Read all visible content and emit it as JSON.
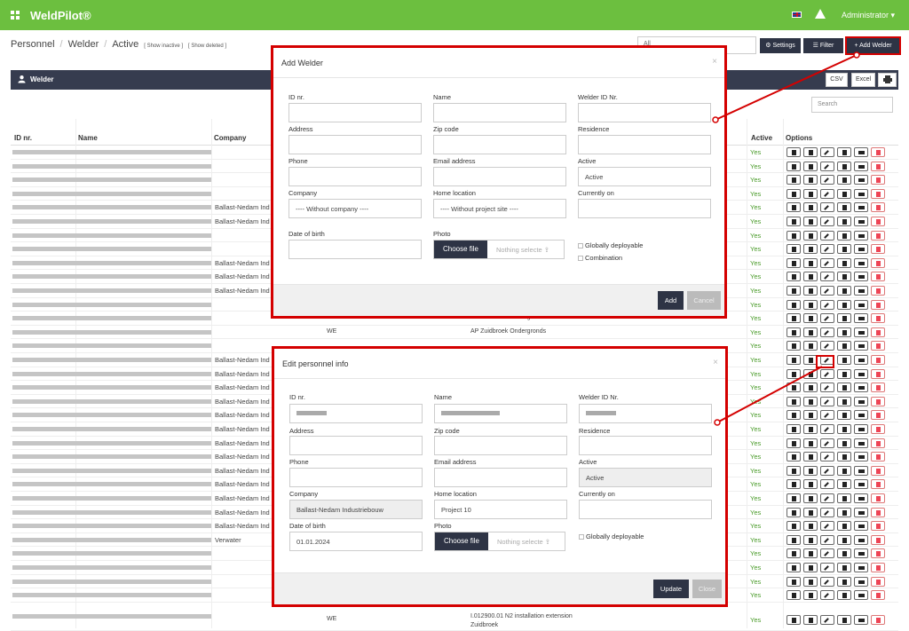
{
  "app": {
    "brand": "WeldPilot®",
    "user": "Administrator ▾"
  },
  "breadcrumb": {
    "personnel": "Personnel",
    "welder": "Welder",
    "active": "Active",
    "show_inactive": "[ Show inactive ]",
    "show_deleted": "[ Show deleted ]"
  },
  "toolbar": {
    "search_value": "All",
    "settings": "⚙ Settings",
    "filter": "☰ Filter",
    "add_welder": "+ Add Welder"
  },
  "section": {
    "title": "Welder",
    "csv": "CSV",
    "excel": "Excel"
  },
  "table": {
    "search_placeholder": "Search",
    "headers": {
      "id": "ID nr.",
      "name": "Name",
      "company": "Company",
      "active": "Active",
      "options": "Options"
    },
    "rows": [
      {
        "company": "",
        "we": "",
        "location": "",
        "active": "Yes"
      },
      {
        "company": "",
        "we": "",
        "location": "",
        "active": "Yes"
      },
      {
        "company": "",
        "we": "",
        "location": "",
        "active": "Yes"
      },
      {
        "company": "",
        "we": "",
        "location": "",
        "active": "Yes"
      },
      {
        "company": "Ballast-Nedam Ind",
        "we": "",
        "location": "",
        "active": "Yes"
      },
      {
        "company": "Ballast-Nedam Ind",
        "we": "",
        "location": "",
        "active": "Yes"
      },
      {
        "company": "",
        "we": "",
        "location": "",
        "active": "Yes"
      },
      {
        "company": "",
        "we": "",
        "location": "",
        "active": "Yes"
      },
      {
        "company": "Ballast-Nedam Ind",
        "we": "",
        "location": "",
        "active": "Yes"
      },
      {
        "company": "Ballast-Nedam Ind",
        "we": "",
        "location": "",
        "active": "Yes"
      },
      {
        "company": "Ballast-Nedam Ind",
        "we": "",
        "location": "",
        "active": "Yes"
      },
      {
        "company": "",
        "we": "",
        "location": "",
        "active": "Yes"
      },
      {
        "company": "",
        "we": "WE",
        "location": "AP Zuidbroek Ondergronds",
        "active": "Yes"
      },
      {
        "company": "",
        "we": "WE",
        "location": "AP Zuidbroek Ondergronds",
        "active": "Yes"
      },
      {
        "company": "",
        "we": "",
        "location": "",
        "active": "Yes"
      },
      {
        "company": "Ballast-Nedam Ind",
        "we": "",
        "location": "",
        "active": "Yes"
      },
      {
        "company": "Ballast-Nedam Ind",
        "we": "",
        "location": "",
        "active": "Yes"
      },
      {
        "company": "Ballast-Nedam Ind",
        "we": "",
        "location": "",
        "active": "Yes"
      },
      {
        "company": "Ballast-Nedam Ind",
        "we": "",
        "location": "",
        "active": "Yes"
      },
      {
        "company": "Ballast-Nedam Ind",
        "we": "",
        "location": "",
        "active": "Yes"
      },
      {
        "company": "Ballast-Nedam Ind",
        "we": "",
        "location": "",
        "active": "Yes"
      },
      {
        "company": "Ballast-Nedam Ind",
        "we": "",
        "location": "",
        "active": "Yes"
      },
      {
        "company": "Ballast-Nedam Ind",
        "we": "",
        "location": "",
        "active": "Yes"
      },
      {
        "company": "Ballast-Nedam Ind",
        "we": "",
        "location": "",
        "active": "Yes"
      },
      {
        "company": "Ballast-Nedam Ind",
        "we": "",
        "location": "",
        "active": "Yes"
      },
      {
        "company": "Ballast-Nedam Ind",
        "we": "",
        "location": "",
        "active": "Yes"
      },
      {
        "company": "Ballast-Nedam Ind",
        "we": "",
        "location": "",
        "active": "Yes"
      },
      {
        "company": "Ballast-Nedam Ind",
        "we": "",
        "location": "",
        "active": "Yes"
      },
      {
        "company": "Verwater",
        "we": "",
        "location": "",
        "active": "Yes"
      },
      {
        "company": "",
        "we": "",
        "location": "",
        "active": "Yes"
      },
      {
        "company": "",
        "we": "",
        "location": "",
        "active": "Yes"
      },
      {
        "company": "",
        "we": "",
        "location": "",
        "active": "Yes"
      },
      {
        "company": "",
        "we": "",
        "location": "",
        "active": "Yes"
      },
      {
        "company": "",
        "we": "WE",
        "location": "I.012900.01 N2 installation extension Zuidbroek",
        "active": "Yes"
      }
    ]
  },
  "add_modal": {
    "title": "Add Welder",
    "close": "×",
    "labels": {
      "id": "ID nr.",
      "name": "Name",
      "welder_id": "Welder ID Nr.",
      "address": "Address",
      "zip": "Zip code",
      "residence": "Residence",
      "phone": "Phone",
      "email": "Email address",
      "active": "Active",
      "company": "Company",
      "home": "Home location",
      "currently": "Currently on",
      "dob": "Date of birth",
      "photo": "Photo"
    },
    "values": {
      "active": "Active",
      "company": "---- Without company ----",
      "home": "---- Without project site ----"
    },
    "choose_file": "Choose file",
    "nothing_selected": "Nothing selecte ⇪",
    "globally": "Globally deployable",
    "combination": "Combination",
    "add": "Add",
    "cancel": "Cancel"
  },
  "edit_modal": {
    "title": "Edit personnel info",
    "close": "×",
    "labels": {
      "id": "ID nr.",
      "name": "Name",
      "welder_id": "Welder ID Nr.",
      "address": "Address",
      "zip": "Zip code",
      "residence": "Residence",
      "phone": "Phone",
      "email": "Email address",
      "active": "Active",
      "company": "Company",
      "home": "Home location",
      "currently": "Currently on",
      "dob": "Date of birth",
      "photo": "Photo"
    },
    "values": {
      "active": "Active",
      "company": "Ballast-Nedam Industriebouw",
      "home": "Project 10",
      "dob": "01.01.2024"
    },
    "choose_file": "Choose file",
    "nothing_selected": "Nothing selecte ⇪",
    "globally": "Globally deployable",
    "update": "Update",
    "close_btn": "Close"
  },
  "colors": {
    "topbar": "#6cbf3f",
    "dark": "#2e3445",
    "highlight": "#d40000",
    "active_green": "#4a9b2a"
  }
}
